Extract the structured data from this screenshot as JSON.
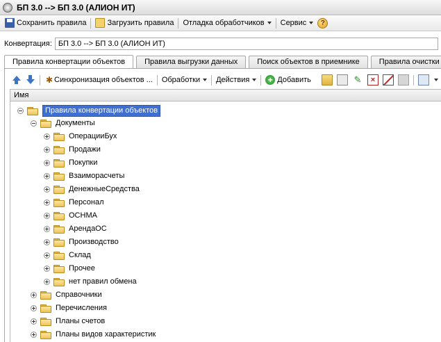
{
  "window": {
    "title": "БП 3.0 --> БП 3.0 (АЛИОН ИТ)"
  },
  "toolbar": {
    "save_label": "Сохранить правила",
    "load_label": "Загрузить правила",
    "debug_label": "Отладка обработчиков",
    "service_label": "Сервис",
    "help_label": "?"
  },
  "conversion": {
    "label": "Конвертация:",
    "value": "БП 3.0 --> БП 3.0 (АЛИОН ИТ)"
  },
  "tabs": [
    {
      "label": "Правила конвертации объектов"
    },
    {
      "label": "Правила выгрузки данных"
    },
    {
      "label": "Поиск объектов в приемнике"
    },
    {
      "label": "Правила очистки д"
    }
  ],
  "actions": {
    "sync_label": "Синхронизация объектов ...",
    "processing_label": "Обработки",
    "actions_label": "Действия",
    "add_label": "Добавить"
  },
  "tree": {
    "column_name": "Имя",
    "root": "Правила конвертации объектов",
    "documents": "Документы",
    "document_groups": [
      "ОперацииБух",
      "Продажи",
      "Покупки",
      "Взаиморасчеты",
      "ДенежныеСредства",
      "Персонал",
      "ОСНМА",
      "АрендаОС",
      "Производство",
      "Склад",
      "Прочее",
      "нет правил обмена"
    ],
    "other_groups": [
      "Справочники",
      "Перечисления",
      "Планы счетов",
      "Планы видов характеристик"
    ]
  }
}
